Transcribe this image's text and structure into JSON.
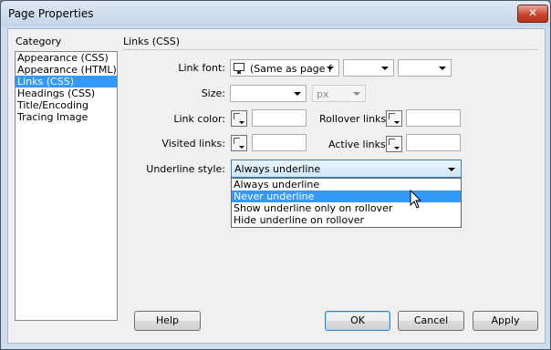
{
  "window": {
    "title": "Page Properties",
    "close_glyph": "✕"
  },
  "category": {
    "header": "Category",
    "items": [
      "Appearance (CSS)",
      "Appearance (HTML)",
      "Links (CSS)",
      "Headings (CSS)",
      "Title/Encoding",
      "Tracing Image"
    ],
    "selected_index": 2
  },
  "section_title": "Links (CSS)",
  "form": {
    "link_font_label": "Link font:",
    "link_font_value": "(Same as page f",
    "size_label": "Size:",
    "size_value": "",
    "size_unit": "px",
    "link_color_label": "Link color:",
    "rollover_links_label": "Rollover links:",
    "visited_links_label": "Visited links:",
    "active_links_label": "Active links:",
    "underline_style_label": "Underline style:",
    "underline_style_value": "Always underline",
    "underline_options": [
      "Always underline",
      "Never underline",
      "Show underline only on rollover",
      "Hide underline on rollover"
    ],
    "highlighted_option_index": 1
  },
  "buttons": {
    "help": "Help",
    "ok": "OK",
    "cancel": "Cancel",
    "apply": "Apply"
  },
  "colors": {
    "selection": "#3399ff",
    "frame": "#cfdced",
    "close_button": "#c8452e"
  }
}
